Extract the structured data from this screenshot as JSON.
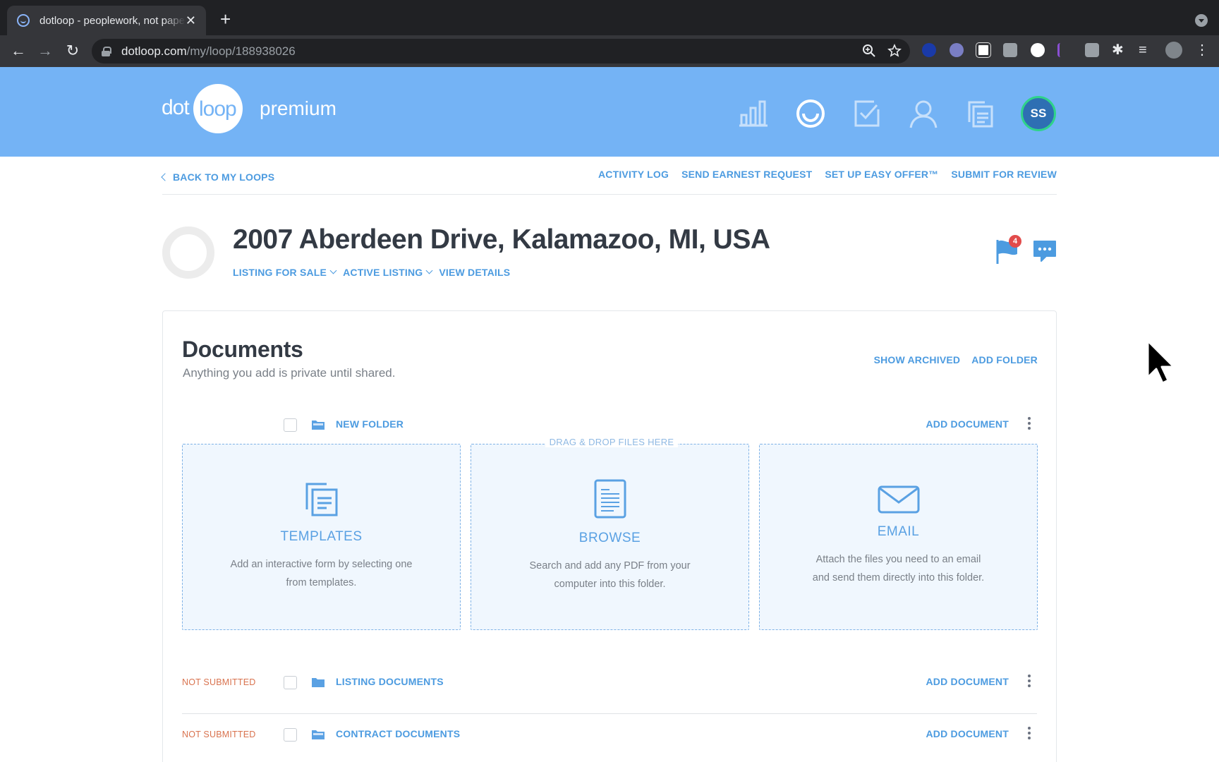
{
  "browser": {
    "tab_title": "dotloop - peoplework, not paperwork",
    "url_host": "dotloop.com",
    "url_path": "/my/loop/188938026"
  },
  "header": {
    "logo_dot": "dot",
    "logo_loop": "loop",
    "logo_suffix": "premium",
    "avatar_initials": "SS",
    "colors": {
      "brand": "#74b3f5",
      "avatar_ring": "#2fd38a"
    }
  },
  "subnav": {
    "back_label": "BACK TO MY LOOPS",
    "actions": [
      "ACTIVITY LOG",
      "SEND EARNEST REQUEST",
      "SET UP EASY OFFER™",
      "SUBMIT FOR REVIEW"
    ]
  },
  "loop": {
    "title": "2007 Aberdeen Drive, Kalamazoo, MI, USA",
    "transaction_type": "LISTING FOR SALE",
    "status": "ACTIVE LISTING",
    "view_details": "VIEW DETAILS",
    "flag_count": "4"
  },
  "documents": {
    "title": "Documents",
    "subtitle": "Anything you add is private until shared.",
    "show_archived": "SHOW ARCHIVED",
    "add_folder": "ADD FOLDER",
    "drop_label": "DRAG & DROP FILES HERE",
    "new_folder": {
      "name": "NEW FOLDER",
      "add": "ADD DOCUMENT"
    },
    "options": [
      {
        "title": "TEMPLATES",
        "desc": "Add an interactive form by selecting one from templates."
      },
      {
        "title": "BROWSE",
        "desc": "Search and add any PDF from your computer into this folder."
      },
      {
        "title": "EMAIL",
        "desc": "Attach the files you need to an email and send them directly into this folder."
      }
    ],
    "folders": [
      {
        "status": "NOT SUBMITTED",
        "name": "LISTING DOCUMENTS",
        "add": "ADD DOCUMENT"
      },
      {
        "status": "NOT SUBMITTED",
        "name": "CONTRACT DOCUMENTS",
        "add": "ADD DOCUMENT"
      }
    ]
  }
}
